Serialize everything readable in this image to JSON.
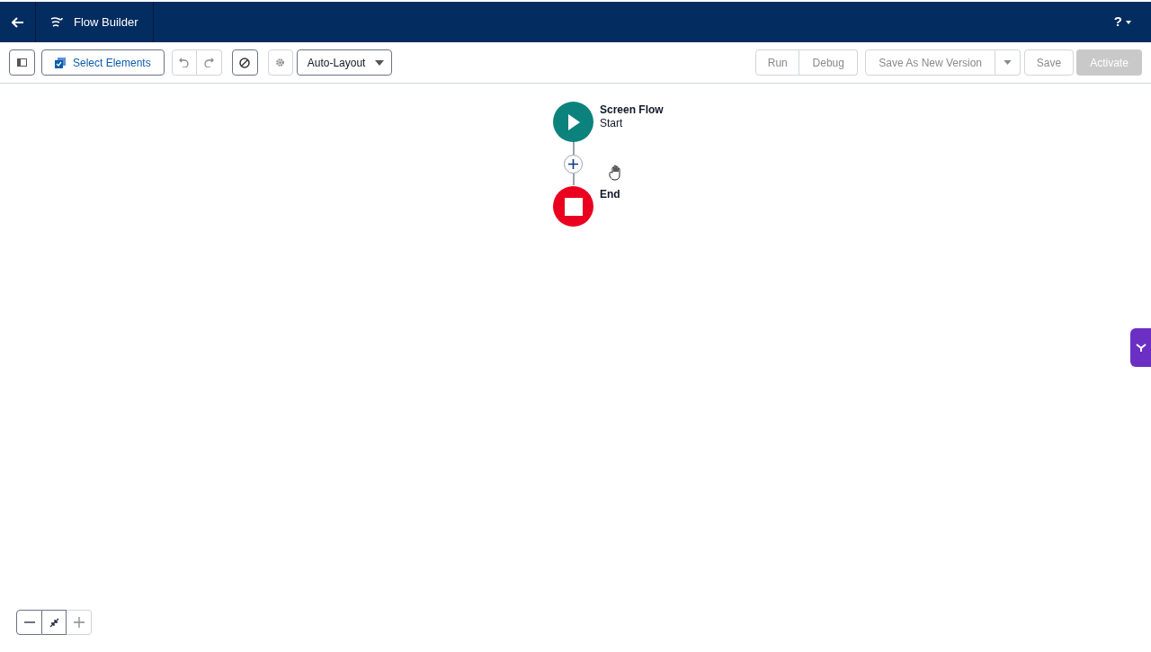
{
  "header": {
    "title": "Flow Builder",
    "help": "?"
  },
  "toolbar": {
    "select_elements": "Select Elements",
    "undo": {
      "disabled": true
    },
    "redo": {
      "disabled": true
    },
    "settings": {
      "disabled": true
    },
    "layout": "Auto-Layout",
    "test_buttons": [
      {
        "label": "Run",
        "disabled": true
      },
      {
        "label": "Debug",
        "disabled": true
      }
    ],
    "save_as": {
      "label": "Save As New Version",
      "disabled": true
    },
    "save": {
      "label": "Save",
      "disabled": true
    },
    "activate": {
      "label": "Activate",
      "disabled": true
    }
  },
  "canvas": {
    "nodes": [
      {
        "kind": "start",
        "title": "Screen Flow",
        "subtitle": "Start"
      },
      {
        "kind": "end",
        "title": "End"
      }
    ]
  },
  "zoom_controls": {
    "zoom_out": {
      "disabled": false
    },
    "fit": {
      "disabled": false
    },
    "zoom_in": {
      "disabled": true
    }
  }
}
